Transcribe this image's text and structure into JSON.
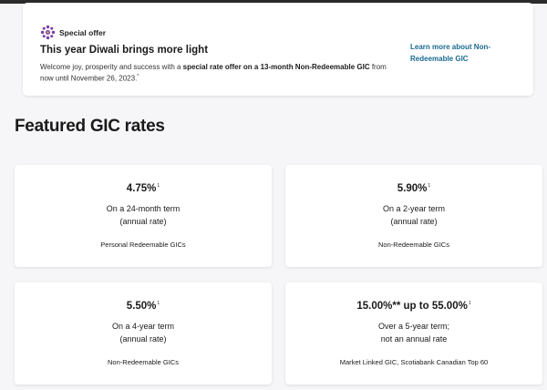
{
  "offer": {
    "badge_label": "Special offer",
    "headline": "This year Diwali brings more light",
    "desc_pre": "Welcome joy, prosperity and success with a ",
    "desc_bold": "special rate offer on a 13-month Non-Redeemable GIC",
    "desc_post": " from now until November 26, 2023.",
    "desc_footnote": "*",
    "link_text": "Learn more about Non-Redeemable GIC",
    "icon_color": "#7a3fa8"
  },
  "section": {
    "title": "Featured GIC rates"
  },
  "cards": [
    {
      "rate": "4.75%",
      "rate_footnote": "1",
      "term_line1": "On a 24-month term",
      "term_line2": "(annual rate)",
      "product": "Personal Redeemable GICs"
    },
    {
      "rate": "5.90%",
      "rate_footnote": "1",
      "term_line1": "On a 2-year term",
      "term_line2": "(annual rate)",
      "product": "Non-Redeemable GICs"
    },
    {
      "rate": "5.50%",
      "rate_footnote": "1",
      "term_line1": "On a 4-year term",
      "term_line2": "(annual rate)",
      "product": "Non-Redeemable GICs"
    },
    {
      "rate": "15.00%** up to 55.00%",
      "rate_footnote": "1",
      "term_line1": "Over a 5-year term;",
      "term_line2": "not an annual rate",
      "product": "Market Linked GIC, Scotiabank Canadian Top 60"
    }
  ],
  "colors": {
    "link": "#1b6a8f",
    "page_bg": "#f6f6f8",
    "card_bg": "#ffffff"
  }
}
